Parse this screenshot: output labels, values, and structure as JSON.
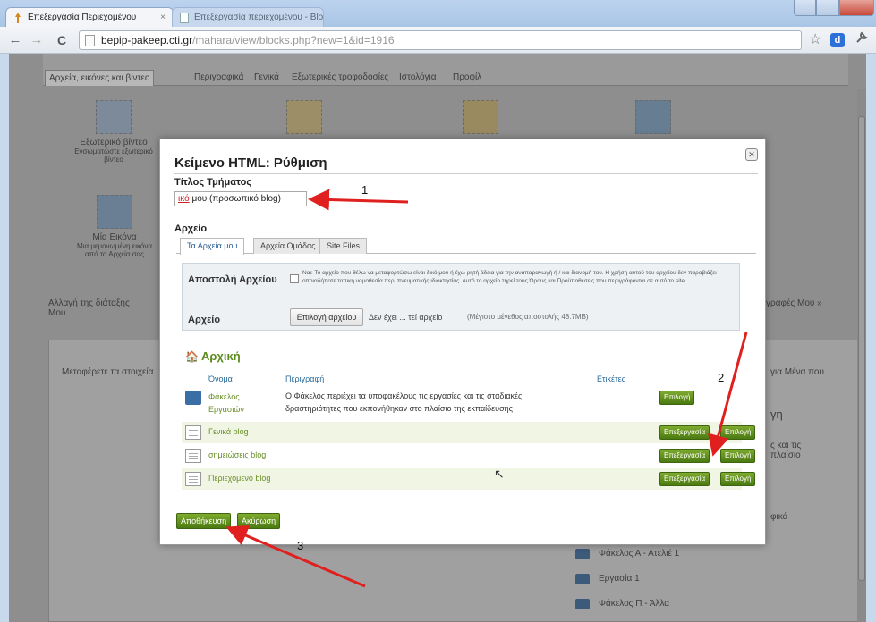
{
  "browser": {
    "tabs": [
      {
        "label": "Επεξεργασία Περιεχομένου",
        "active": true
      },
      {
        "label": "Επεξεργασία περιεχομένου - Blogger - Google Chrome",
        "active": false
      }
    ],
    "tab_close": "×",
    "url_host": "bepip-pakeep.cti.gr",
    "url_path": "/mahara/view/blocks.php?new=1&id=1916",
    "back": "←",
    "forward": "→",
    "reload": "C",
    "star": "☆",
    "ext": "d",
    "wrench": "🔧"
  },
  "background_page": {
    "tabs": [
      "Αρχεία, εικόνες και βίντεο",
      "Περιγραφικά",
      "Γενικά",
      "Εξωτερικές τροφοδοσίες",
      "Ιστολόγια",
      "Προφίλ"
    ],
    "blocks": [
      {
        "label": "Εξωτερικό βίντεο",
        "sub": "Ενσωματώστε εξωτερικό βίντεο"
      },
      {
        "label": "",
        "sub": ""
      },
      {
        "label": "",
        "sub": ""
      },
      {
        "label": "",
        "sub": ""
      },
      {
        "label": "Μία Εικόνα",
        "sub": "Μια μεμονωμένη εικόνα από τα Αρχεία σας"
      }
    ],
    "left_link": "Αλλαγή της διάταξης",
    "left_link2": "Μου",
    "right_link": "γραφές Μου »",
    "inner_left_text": "Μεταφέρετε τα στοιχεία",
    "inner_right_text": "για Μένα που",
    "right_panel_title": "γη",
    "right_panel_text": "ς και τις\nπλαίσιο",
    "right_panel_link": "φικά",
    "folders": [
      "Φάκελος Α - Ατελιέ 1",
      "Εργασία 1",
      "Φάκελος Π - Άλλα"
    ]
  },
  "modal": {
    "title": "Κείμενο HTML: Ρύθμιση",
    "close_icon": "✕",
    "block_title_label": "Τίτλος Τμήματος",
    "block_title_value_error": "ικό",
    "block_title_value_rest": " μου (προσωπικό blog)",
    "file_label": "Αρχείο",
    "file_tabs": [
      "Τα Αρχεία μου",
      "Αρχεία Ομάδας",
      "Site Files"
    ],
    "upload": {
      "label": "Αποστολή Αρχείου",
      "notice": "Ναι: Το αρχείο που θέλω να μεταφορτώσω είναι δικό μου ή έχω ρητή άδεια για την αναπαραγωγή ή / και διανομή του. Η χρήση αυτού του αρχείου δεν παραβιάζει οποιαδήποτε τοπική νομοθεσία περί πνευματικής ιδιοκτησίας. Αυτό το αρχείο τηρεί τους Όρους και Προϋποθέσεις που περιγράφονται σε αυτό το site.",
      "file_label": "Αρχείο",
      "choose_button": "Επιλογή αρχείου",
      "no_file": "Δεν έχει ... τεί αρχείο",
      "max_size": "(Μέγιστο μέγεθος αποστολής 48.7MB)"
    },
    "home_label": "Αρχική",
    "home_icon": "🏠",
    "columns": {
      "name": "Όνομα",
      "description": "Περιγραφή",
      "tags": "Ετικέτες"
    },
    "rows": [
      {
        "name": "Φάκελος",
        "name_sub": "Εργασιών",
        "description": "Ο Φάκελος περιέχει τα υποφακέλους τις εργασίες και τις σταδιακές",
        "description_sub": "δραστηριότητες που εκπονήθηκαν στο πλαίσιο της εκπαίδευσης",
        "type": "folder",
        "buttons": [
          "Επιλογή"
        ]
      },
      {
        "name": "Γενικά blog",
        "name_sub": "",
        "description": "",
        "description_sub": "",
        "type": "doc",
        "buttons": [
          "Επεξεργασία",
          "Επιλογή"
        ]
      },
      {
        "name": "σημειώσεις blog",
        "name_sub": "",
        "description": "",
        "description_sub": "",
        "type": "doc",
        "buttons": [
          "Επεξεργασία",
          "Επιλογή"
        ]
      },
      {
        "name": "Περιεχόμενο blog",
        "name_sub": "",
        "description": "",
        "description_sub": "",
        "type": "doc",
        "buttons": [
          "Επεξεργασία",
          "Επιλογή"
        ]
      }
    ],
    "save_button": "Αποθήκευση",
    "cancel_button": "Ακύρωση"
  },
  "annotations": {
    "n1": "1",
    "n2": "2",
    "n3": "3",
    "arrow_color": "#e0201e"
  },
  "cursor": "↖"
}
